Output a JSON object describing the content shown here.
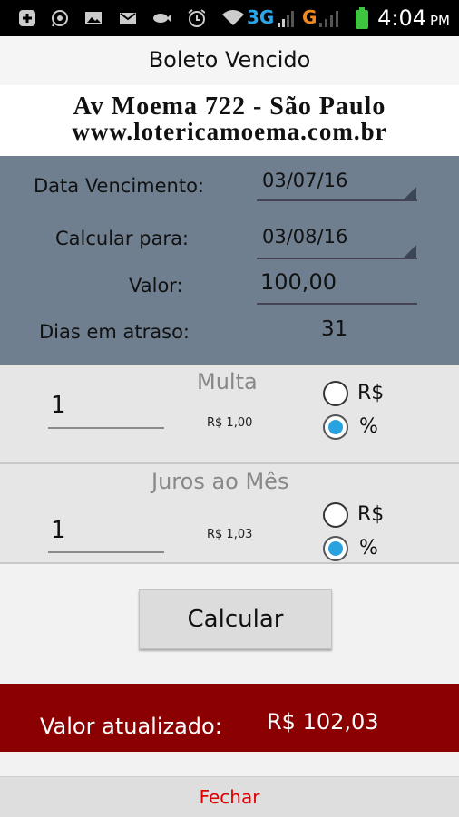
{
  "status_bar": {
    "network_3g": "3G",
    "network_g": "G",
    "time": "4:04",
    "ampm": "PM",
    "icons": [
      "notification-plus-icon",
      "whatsapp-icon",
      "image-icon",
      "gmail-icon",
      "fish-icon",
      "alarm-icon",
      "wifi-icon",
      "signal-icon",
      "battery-icon"
    ]
  },
  "header": {
    "title": "Boleto Vencido"
  },
  "banner": {
    "line1": "Av Moema 722 - São Paulo",
    "line2": "www.lotericamoema.com.br"
  },
  "form": {
    "due_date_label": "Data Vencimento:",
    "due_date_value": "03/07/16",
    "calc_for_label": "Calcular para:",
    "calc_for_value": "03/08/16",
    "amount_label": "Valor:",
    "amount_value": "100,00",
    "days_late_label": "Dias em atraso:",
    "days_late_value": "31"
  },
  "multa": {
    "title": "Multa",
    "value": "1",
    "computed": "R$ 1,00",
    "option_currency": "R$",
    "option_percent": "%",
    "selected": "%"
  },
  "juros": {
    "title": "Juros ao Mês",
    "value": "1",
    "computed": "R$ 1,03",
    "option_currency": "R$",
    "option_percent": "%",
    "selected": "%"
  },
  "actions": {
    "calculate": "Calcular",
    "close": "Fechar"
  },
  "result": {
    "label": "Valor atualizado:",
    "value": "R$ 102,03"
  },
  "colors": {
    "form_bg": "#6f7f8f",
    "result_bg": "#8b0000",
    "close_text": "#e00000",
    "radio_selected": "#29a3e0"
  }
}
